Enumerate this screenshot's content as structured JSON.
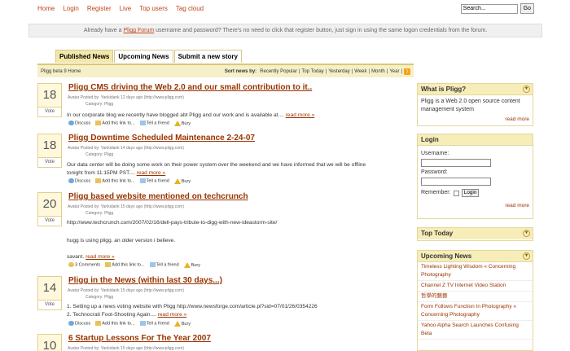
{
  "nav": {
    "items": [
      "Home",
      "Login",
      "Register",
      "Live",
      "Top users",
      "Tag cloud"
    ]
  },
  "search": {
    "placeholder": "Search...",
    "button": "Go"
  },
  "notice": {
    "pre": "Already have a ",
    "link": "Pligg Forum",
    "post": " username and password? There's no need to click that register button, just sign in using the same logon credentials from the forum."
  },
  "tabs": [
    {
      "label": "Published News",
      "active": true
    },
    {
      "label": "Upcoming News",
      "active": false
    },
    {
      "label": "Submit a new story",
      "active": false
    }
  ],
  "breadcrumb": "Pligg beta 9 Home",
  "sort": {
    "label": "Sort news by:",
    "options": [
      "Recently Popular",
      "Top Today",
      "Yesterday",
      "Week",
      "Month",
      "Year"
    ]
  },
  "stories": [
    {
      "votes": "18",
      "vote_label": "Vote",
      "title": "Pligg CMS driving the Web 2.0 and our small contribution to it..",
      "avatar": "Avatar",
      "posted": "Posted by: Yankidank 12 days ago (http://www.pligg.com)",
      "category": "Category: Pligg",
      "body": [
        "In our corporate blog we recently have blogged abt Pligg and our work and is available at...."
      ],
      "readmore": "read more »",
      "actions": [
        "Discuss",
        "Add this link to...",
        "Tell a friend",
        "Bury"
      ]
    },
    {
      "votes": "18",
      "vote_label": "Vote",
      "title": "Pligg Downtime Scheduled Maintenance 2-24-07",
      "avatar": "Avatar",
      "posted": "Posted by: Yankidank 14 days ago (http://www.pligg.com)",
      "category": "Category: Pligg",
      "body": [
        "Our data center will be doing some work on their power system over the weekend and we have informed that we will be offline",
        "tonight from 11:15PM PST...."
      ],
      "readmore": "read more »",
      "actions": [
        "Discuss",
        "Add this link to...",
        "Tell a friend",
        "Bury"
      ]
    },
    {
      "votes": "20",
      "vote_label": "Vote",
      "title": "Pligg based website mentioned on techcrunch",
      "avatar": "Avatar",
      "posted": "Posted by: Yankidank 15 days ago (http://www.pligg.com)",
      "category": "Category: Pligg",
      "body": [
        "http://www.techcrunch.com/2007/02/16/dell-pays-tribute-to-digg-with-new-ideastorm-site/",
        "",
        "hugg is using pligg. an older version i believe.",
        "",
        "savant."
      ],
      "readmore": "read more »",
      "actions": [
        "3 Comments",
        "Add this link to...",
        "Tell a friend",
        "Bury"
      ]
    },
    {
      "votes": "14",
      "vote_label": "Vote",
      "title": "Pligg in the News (within last 30 days...)",
      "avatar": "Avatar",
      "posted": "Posted by: Yankidank 15 days ago (http://www.pligg.com)",
      "category": "Category: Pligg",
      "body": [
        "1. Setting up a news voting website with Pligg http://www.newsforge.com/article.pl?sid=07/01/26/0354226",
        "2. Technocrati Foot-Shooting Again...."
      ],
      "readmore": "read more »",
      "actions": [
        "Discuss",
        "Add this link to...",
        "Tell a friend",
        "Bury"
      ]
    },
    {
      "votes": "10",
      "vote_label": "Vote",
      "title": "6 Startup Lessons For The Year 2007",
      "avatar": "Avatar",
      "posted": "Posted by: Yankidank 15 days ago (http://www.pligg.com)",
      "category": "",
      "body": [],
      "readmore": "",
      "actions": []
    }
  ],
  "sidebar": {
    "what": {
      "title": "What is Pligg?",
      "text": "Pligg is a Web 2.0 open source content management system",
      "more": "read more"
    },
    "login": {
      "title": "Login",
      "username": "Username:",
      "password": "Password:",
      "remember": "Remember:",
      "button": "Login",
      "more": "read more"
    },
    "top_today": {
      "title": "Top Today"
    },
    "upcoming": {
      "title": "Upcoming News",
      "items": [
        "Timeless Lighting Wisdom « Concerning Photography",
        "Channel Z TV Internet Video Station",
        "哲學的魅藝",
        "Form Follows Function In Photography « Concerning Photography",
        "Yahoo Alpha Search Launches Confusing Beta"
      ]
    }
  }
}
